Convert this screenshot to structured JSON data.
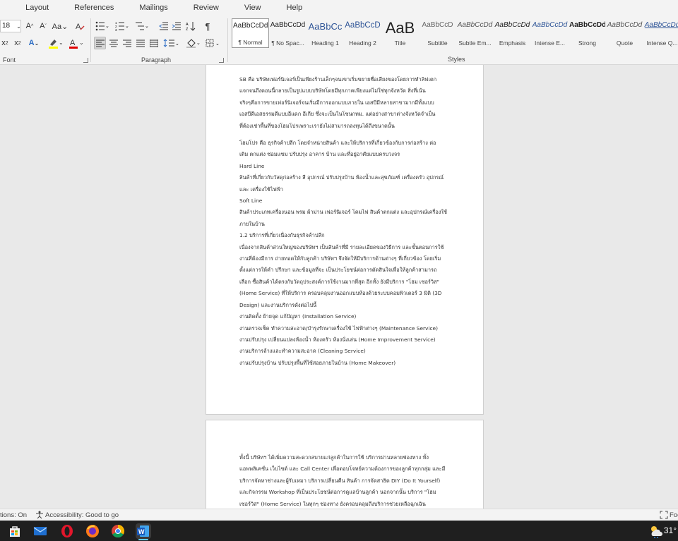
{
  "menubar": {
    "items": [
      "ayout-partial",
      "Layout",
      "References",
      "Mailings",
      "Review",
      "View",
      "Help"
    ]
  },
  "menu_labels": [
    "Layout",
    "References",
    "Mailings",
    "Review",
    "View",
    "Help"
  ],
  "ribbon": {
    "font_size": "18",
    "font_group_label": "Font",
    "paragraph_group_label": "Paragraph",
    "styles_group_label": "Styles",
    "styles": [
      {
        "sample": "AaBbCcDd",
        "name": "¶ Normal"
      },
      {
        "sample": "AaBbCcDd",
        "name": "¶ No Spac..."
      },
      {
        "sample": "AaBbCc",
        "name": "Heading 1"
      },
      {
        "sample": "AaBbCcD",
        "name": "Heading 2"
      },
      {
        "sample": "AaB",
        "name": "Title"
      },
      {
        "sample": "AaBbCcD",
        "name": "Subtitle"
      },
      {
        "sample": "AaBbCcDd",
        "name": "Subtle Em..."
      },
      {
        "sample": "AaBbCcDd",
        "name": "Emphasis"
      },
      {
        "sample": "AaBbCcDd",
        "name": "Intense E..."
      },
      {
        "sample": "AaBbCcDd",
        "name": "Strong"
      },
      {
        "sample": "AaBbCcDd",
        "name": "Quote"
      },
      {
        "sample": "AaBbCcDd",
        "name": "Intense Q..."
      }
    ]
  },
  "page1": {
    "para1": [
      "SB คือ บริษัทเฟอร์นิเจอร์เป็นเพียงร้านเล็กๆจนเขาเริ่มขยายชื่อเสียงของโดยการทำลิฟเตก",
      "แจกจนถึงตอนนี้กลายเป็นรูปแบบบริษัทโดยมีทุกภาคเพียงแต่ไม่ใช่ทุกจังหวัด สิ่งที่เน้น",
      "จริงๆคือการขายเฟอร์นิเจอร์จนเริ่มมีการออกแบบภายใน เอสบีมีหลายสาขามากมีทั้งแบบ",
      "เอสบีดีเอสธรรมดีแบบอีแดก อีเกีย ซึ่งจะเป็นในโซนกทม. แต่อย่างสาขาต่างจังหวัดจำเป็น",
      "ที่ต้องเช่าพื้นที่ของโฮมโปรเพราะเรายังไม่สามารถลงทุนได้ถึงขนาดนั้น"
    ],
    "para2": [
      "โฮมโปร คือ ธุรกิจค้าปลีก โดยจำหน่ายสินค้า และให้บริการที่เกี่ยวข้องกับการก่อสร้าง ต่อ",
      "เติม ตกแต่ง ซ่อมแซม ปรับปรุง อาคาร บ้าน และที่อยู่อาศัยแบบครบวงจร",
      "Hard Line",
      "สินค้าที่เกี่ยวกับวัสดุก่อสร้าง สี อุปกรณ์ ปรับปรุงบ้าน ห้องน้ำและสุขภัณฑ์ เครื่องครัว อุปกรณ์",
      "และ เครื่องใช้ไฟฟ้า",
      "Soft Line",
      "สินค้าประเภทเครื่องนอน พรม ผ้าม่าน เฟอร์นิเจอร์ โคมไฟ สินค้าตกแต่ง และอุปกรณ์เครื่องใช้",
      "ภายในบ้าน",
      "1.2 บริการที่เกี่ยวเนื่องกับธุรกิจค้าปลีก",
      "เนื่องจากสินค้าส่วนใหญ่ของบริษัทฯ เป็นสินค้าที่มี รายละเอียดของวิธีการ และขั้นตอนการใช้",
      "งานที่ต้องมีการ ถ่ายทอดให้กับลูกค้า บริษัทฯ จึงจัดให้มีบริการด้านต่างๆ ที่เกี่ยวข้อง โดยเริ่ม",
      "ตั้งแต่การให้คำ ปรึกษา และข้อมูลที่จะ เป็นประโยชน์ต่อการตัดสินใจเพื่อให้ลูกค้าสามารถ",
      "เลือก ซื้อสินค้าได้ตรงกับวัตถุประสงค์การใช้งานมากที่สุด อีกทั้ง ยังมีบริการ \"โฮม เซอร์วิส\"",
      "(Home Service) ที่ให้บริการ ครอบคลุมงานออกแบบห้องด้วยระบบคอมพิวเตอร์ 3 มิติ (3D",
      "Design) และงานบริการดังต่อไปนี้",
      "งานติดตั้ง ย้ายจุด แก้ปัญหา (Installation Service)",
      "งานตรวจเช็ค ทำความสะอาด/บำรุงรักษาเครื่องใช้ ไฟฟ้าต่างๆ (Maintenance Service)",
      "งานปรับปรุง เปลี่ยนแปลงห้องน้ำ ห้องครัว ห้องนั่งเล่น (Home Improvement Service)",
      "งานบริการล้างและทำความสะอาด (Cleaning Service)",
      "งานปรับปรุงบ้าน ปรับปรุงพื้นที่ใช้สอยภายในบ้าน (Home Makeover)"
    ]
  },
  "page2": {
    "para1": [
      "ทั้งนี้ บริษัทฯ ได้เพิ่มความสะดวกสบายแก่ลูกค้าในการใช้ บริการผ่านหลายช่องทาง ทั้ง",
      "แอพพลิเคชั่น เว็บไซต์ และ Call Center เพื่อตอบโจทย์ความต้องการของลูกค้าทุกกลุ่ม และมี",
      "บริการจัดหาช่างและผู้รับเหมา บริการเปลี่ยนคืน สินค้า การจัดสาธิต DIY (Do It Yourself)",
      "และกิจกรรม Workshop ที่เป็นประโยชน์ต่อการดูแลบ้านลูกค้า นอกจากนั้น บริการ \"โฮม",
      "เซอร์วิส\" (Home Service) ในทุกๆ ช่องทาง ยังครอบคลุมถึงบริการช่วยเหลือฉุกเฉิน"
    ]
  },
  "statusbar": {
    "words": "tions: On",
    "accessibility": "Accessibility: Good to go",
    "focus": "Foc"
  },
  "taskbar": {
    "apps": [
      "store-icon",
      "mail-icon",
      "opera-icon",
      "firefox-icon",
      "chrome-icon",
      "word-icon"
    ],
    "temperature": "31°"
  },
  "colors": {
    "accent": "#2b579a",
    "highlight": "#ffff00",
    "font_color": "#e00000"
  }
}
